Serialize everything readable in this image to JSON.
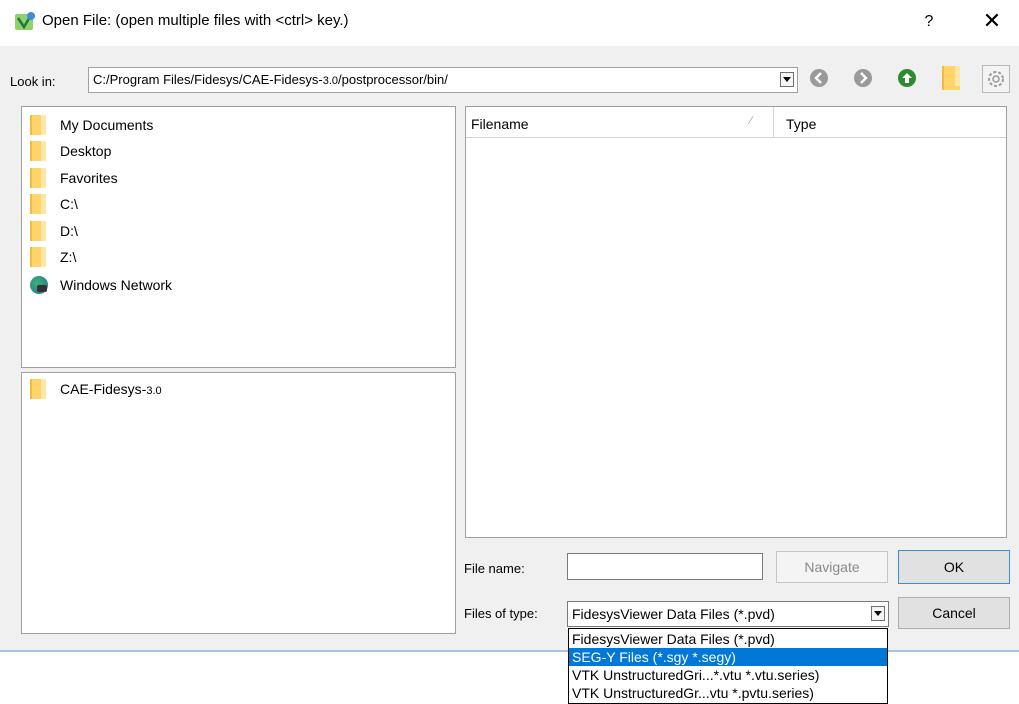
{
  "window": {
    "title": "Open File:  (open multiple files with <ctrl> key.)",
    "help_label": "?",
    "close_label": "✕"
  },
  "look_in": {
    "label": "Look in:",
    "path_main": "C:/Program Files/Fidesys/CAE-Fidesys-",
    "path_version": "3.0",
    "path_rest": "/postprocessor/bin/"
  },
  "sidebar": {
    "items": [
      {
        "label": "My Documents",
        "icon": "folder-icon"
      },
      {
        "label": "Desktop",
        "icon": "folder-icon"
      },
      {
        "label": "Favorites",
        "icon": "folder-icon"
      },
      {
        "label": "C:\\",
        "icon": "folder-icon"
      },
      {
        "label": "D:\\",
        "icon": "folder-icon"
      },
      {
        "label": "Z:\\",
        "icon": "folder-icon"
      },
      {
        "label": "Windows Network",
        "icon": "network-globe-icon"
      }
    ]
  },
  "history": {
    "items": [
      {
        "label": "CAE-Fidesys-",
        "version": "3.0",
        "icon": "folder-icon"
      }
    ]
  },
  "file_list": {
    "columns": [
      "Filename",
      "Type"
    ],
    "sort_indicator": "⁄"
  },
  "bottom": {
    "filename_label": "File name:",
    "filename_value": "",
    "navigate_label": "Navigate",
    "ok_label": "OK",
    "cancel_label": "Cancel",
    "filetype_label": "Files of type:",
    "filetype_value": "FidesysViewer Data Files (*.pvd)"
  },
  "dropdown": {
    "options": [
      "FidesysViewer Data Files (*.pvd)",
      "SEG-Y Files (*.sgy *.segy)",
      "VTK UnstructuredGri...*.vtu *.vtu.series)",
      "VTK UnstructuredGr...vtu *.pvtu.series)"
    ],
    "selected_index": 1
  },
  "colors": {
    "selection": "#0078d7",
    "up_arrow": "#2e8b2e",
    "nav_disabled": "#9a9a9a",
    "folder": "#ffd46b"
  }
}
